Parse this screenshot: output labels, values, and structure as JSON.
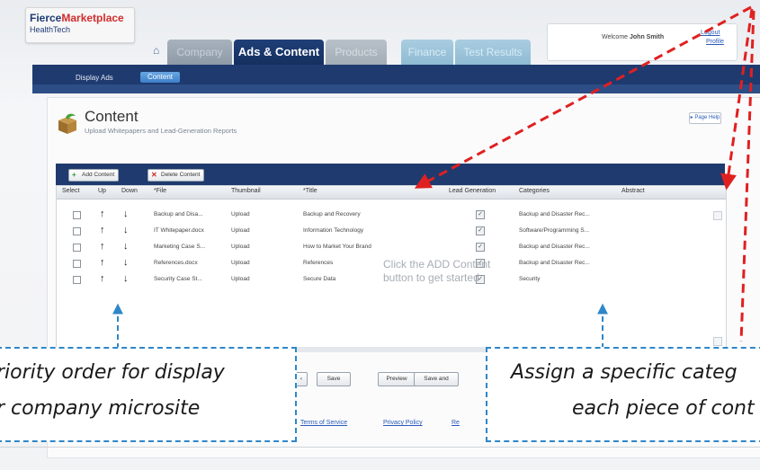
{
  "header": {
    "logo_primary": "Fierce",
    "logo_secondary": "Marketplace",
    "logo_sub": "HealthTech",
    "tabs": [
      {
        "label": "Company"
      },
      {
        "label": "Ads & Content"
      },
      {
        "label": "Products"
      },
      {
        "label": "Finance"
      },
      {
        "label": "Test Results"
      }
    ],
    "welcome_prefix": "Welcome",
    "user_name": "John Smith",
    "logout": "Logout",
    "profile": "Profile"
  },
  "subnav": {
    "display_ads": "Display Ads",
    "content": "Content"
  },
  "page": {
    "title": "Content",
    "subtitle": "Upload Whitepapers and Lead-Generation Reports",
    "help": "Page Help"
  },
  "toolbar": {
    "add": "Add Content",
    "delete": "Delete Content"
  },
  "grid": {
    "columns": [
      "Select",
      "Up",
      "Down",
      "*File",
      "Thumbnail",
      "*Title",
      "Lead Generation",
      "Categories",
      "Abstract"
    ],
    "rows": [
      {
        "file": "Backup and Disa...",
        "thumbnail": "Upload",
        "title": "Backup and Recovery",
        "lead": true,
        "category": "Backup and Disaster Rec..."
      },
      {
        "file": "IT Whitepaper.docx",
        "thumbnail": "Upload",
        "title": "Information Technology",
        "lead": true,
        "category": "Software/Programming S..."
      },
      {
        "file": "Marketing Case S...",
        "thumbnail": "Upload",
        "title": "How to Market Your Brand",
        "lead": true,
        "category": "Backup and Disaster Rec..."
      },
      {
        "file": "References.docx",
        "thumbnail": "Upload",
        "title": "References",
        "lead": true,
        "category": "Backup and Disaster Rec..."
      },
      {
        "file": "Security Case St...",
        "thumbnail": "Upload",
        "title": "Secure Data",
        "lead": true,
        "category": "Security"
      }
    ],
    "overlay_line1": "Click the ADD Content",
    "overlay_line2": "button to get started"
  },
  "footer_buttons": {
    "save": "Save",
    "preview": "Preview",
    "save_and": "Save and"
  },
  "footer_links": {
    "terms": "Terms of Service",
    "privacy": "Privacy Policy",
    "third": "Re"
  },
  "callouts": {
    "left_line1": "riority order for display",
    "left_line2": "r company microsite",
    "right_line1": "Assign a specific categ",
    "right_line2": "each piece of cont"
  },
  "colors": {
    "navy": "#1e3a6f",
    "red_arrow": "#e02020",
    "blue_callout": "#2e87c8"
  }
}
